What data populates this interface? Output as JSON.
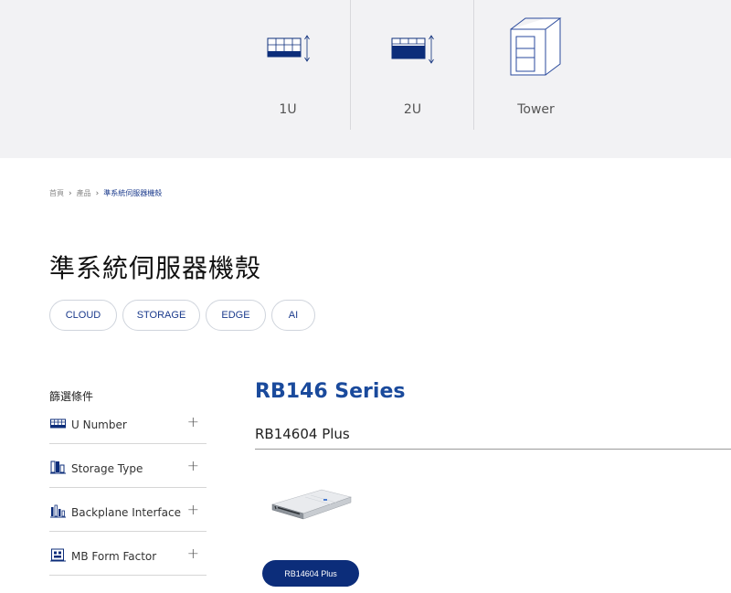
{
  "categories": [
    {
      "label": "1U",
      "icon": "1u-rack-server-icon"
    },
    {
      "label": "2U",
      "icon": "2u-rack-server-icon"
    },
    {
      "label": "Tower",
      "icon": "tower-server-icon"
    }
  ],
  "breadcrumb": {
    "home": "首頁",
    "products": "產品",
    "current": "準系統伺服器機殼"
  },
  "page": {
    "title": "準系統伺服器機殼"
  },
  "tags": [
    "CLOUD",
    "STORAGE",
    "EDGE",
    "AI"
  ],
  "filters": {
    "heading": "篩選條件",
    "items": [
      {
        "label": "U Number",
        "icon": "u-number-icon"
      },
      {
        "label": "Storage Type",
        "icon": "storage-type-icon"
      },
      {
        "label": "Backplane Interface",
        "icon": "backplane-icon"
      },
      {
        "label": "MB Form Factor",
        "icon": "mb-form-factor-icon"
      }
    ],
    "expand_glyph": "+"
  },
  "product": {
    "series_title": "RB146 Series",
    "model_name": "RB14604 Plus",
    "button_label": "RB14604 Plus"
  },
  "colors": {
    "accent": "#1a3a8c",
    "button_bg": "#0c2d7a",
    "strip_bg": "#f2f2f4"
  }
}
